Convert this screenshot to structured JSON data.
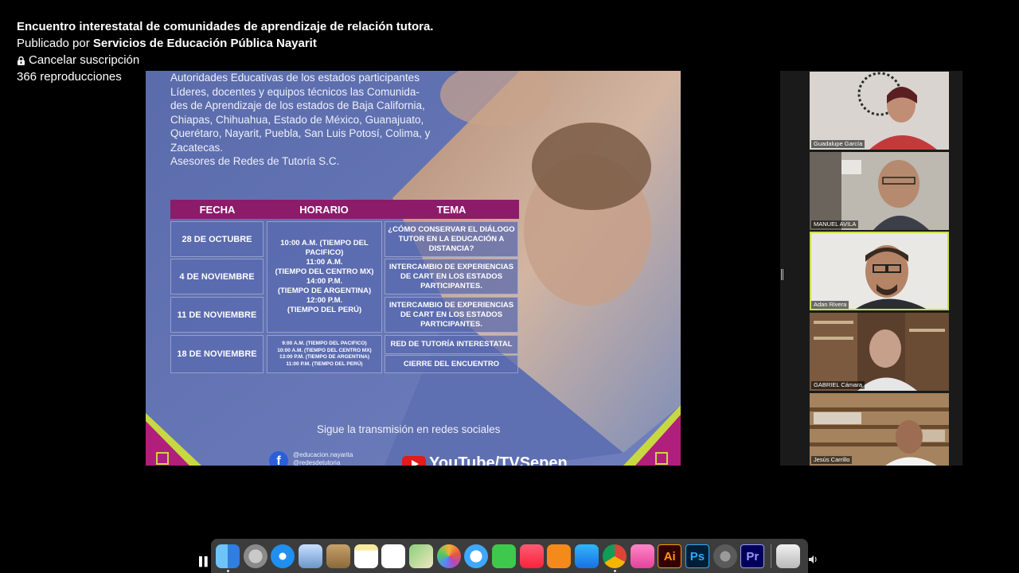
{
  "video": {
    "title": "Encuentro interestatal de comunidades de aprendizaje de relación tutora.",
    "published_prefix": "Publicado por",
    "publisher": "Servicios de Educación Pública Nayarit",
    "unsubscribe_label": "Cancelar suscripción",
    "views": "366 reproducciones"
  },
  "slide": {
    "intro": "Autoridades Educativas de los estados participantes\nLíderes, docentes y equipos técnicos las Comunida-\ndes de Aprendizaje de los estados de  Baja California,\nChiapas, Chihuahua, Estado de México, Guanajuato,\nQuerétaro, Nayarit, Puebla, San Luis Potosí, Colima, y\nZacatecas.\nAsesores de Redes de Tutoría S.C.",
    "headers": [
      "FECHA",
      "HORARIO",
      "TEMA"
    ],
    "dates": [
      "28 DE OCTUBRE",
      "4 DE NOVIEMBRE",
      "11 DE NOVIEMBRE",
      "18 DE NOVIEMBRE"
    ],
    "schedule_main": "10:00 A.M. (TIEMPO DEL PACIFICO)\n11:00 A.M.\n(TIEMPO DEL CENTRO MX)\n14:00 P.M.\n(TIEMPO DE ARGENTINA)\n12:00 P.M.\n(TIEMPO DEL PERÚ)",
    "schedule_last": "9:00 A.M. (TIEMPO DEL PACIFICO)\n10:00 A.M. (TIEMPO DEL CENTRO MX)\n13:00 P.M. (TIEMPO DE ARGENTINA)\n11:00 P.M. (TIEMPO DEL PERÚ)",
    "topics": [
      "¿CÓMO CONSERVAR EL DIÁLOGO TUTOR EN LA EDUCACIÓN A DISTANCIA?",
      "INTERCAMBIO DE EXPERIENCIAS DE CART EN LOS ESTADOS PARTICIPANTES.",
      "INTERCAMBIO DE EXPERIENCIAS DE CART EN LOS ESTADOS PARTICIPANTES.",
      "RED DE TUTORÍA INTERESTATAL",
      "CIERRE DEL ENCUENTRO"
    ],
    "follow_text": "Sigue la transmisión en redes sociales",
    "fb_handles": "@educacion.nayarita\n@redesdetutoria",
    "yt_text": "YouTube/TVSepen"
  },
  "participants": [
    {
      "name": "Guadalupe García"
    },
    {
      "name": "MANUEL AVILA"
    },
    {
      "name": "Adan Rivera",
      "active": true
    },
    {
      "name": "GABRIEL Cámara"
    },
    {
      "name": "Jesús Carrillo"
    }
  ],
  "dock": {
    "apps": [
      {
        "icon": "finder-icon",
        "label": ""
      },
      {
        "icon": "launchpad-icon",
        "label": ""
      },
      {
        "icon": "safari-icon",
        "label": ""
      },
      {
        "icon": "preview-icon",
        "label": ""
      },
      {
        "icon": "contacts-icon",
        "label": ""
      },
      {
        "icon": "notes-icon",
        "label": ""
      },
      {
        "icon": "reminders-icon",
        "label": ""
      },
      {
        "icon": "maps-icon",
        "label": ""
      },
      {
        "icon": "photos-icon",
        "label": ""
      },
      {
        "icon": "messages-icon",
        "label": ""
      },
      {
        "icon": "facetime-icon",
        "label": ""
      },
      {
        "icon": "music-icon",
        "label": ""
      },
      {
        "icon": "books-icon",
        "label": ""
      },
      {
        "icon": "app-store-icon",
        "label": ""
      },
      {
        "icon": "chrome-icon",
        "label": ""
      },
      {
        "icon": "folder-icon",
        "label": ""
      },
      {
        "icon": "illustrator-icon",
        "label": "Ai"
      },
      {
        "icon": "photoshop-icon",
        "label": "Ps"
      },
      {
        "icon": "system-preferences-icon",
        "label": ""
      },
      {
        "icon": "premiere-icon",
        "label": "Pr"
      },
      {
        "icon": "trash-icon",
        "label": ""
      }
    ]
  }
}
